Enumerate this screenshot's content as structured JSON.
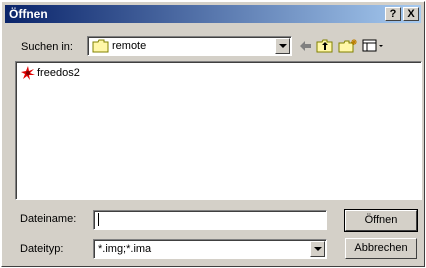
{
  "window": {
    "title": "Öffnen",
    "help_button": "?",
    "close_button": "X"
  },
  "lookin": {
    "label": "Suchen in:",
    "value": "remote"
  },
  "toolbar": {
    "icons": [
      "back-arrow-icon",
      "up-folder-icon",
      "new-folder-icon",
      "view-menu-icon"
    ]
  },
  "files": [
    {
      "name": "freedos2",
      "icon": "disk-image-icon"
    }
  ],
  "filename": {
    "label": "Dateiname:",
    "value": ""
  },
  "filetype": {
    "label": "Dateityp:",
    "value": "*.img;*.ima"
  },
  "buttons": {
    "open": "Öffnen",
    "cancel": "Abbrechen"
  }
}
